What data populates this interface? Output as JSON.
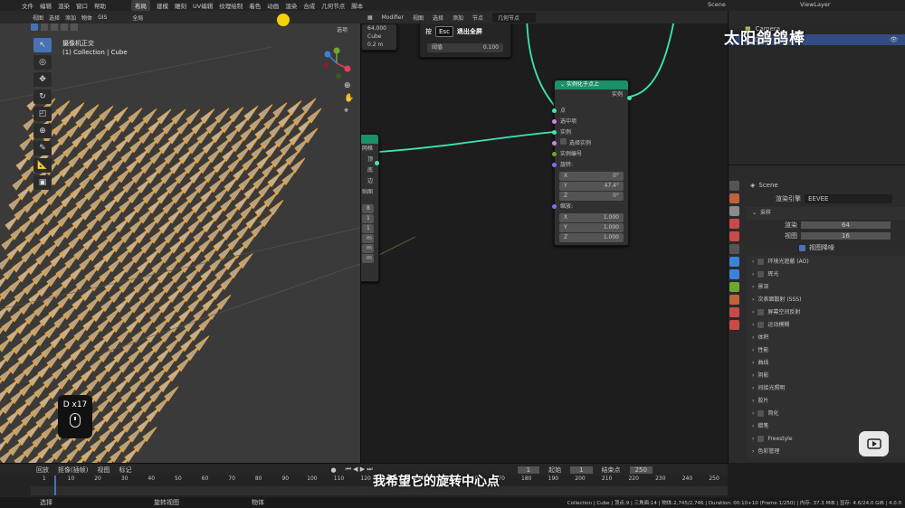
{
  "topbar": {
    "menus": [
      "文件",
      "编辑",
      "渲染",
      "窗口",
      "帮助"
    ],
    "workspaces": [
      "布局",
      "建模",
      "雕刻",
      "UV编辑",
      "纹理绘制",
      "着色",
      "动画",
      "渲染",
      "合成",
      "几何节点",
      "脚本"
    ],
    "active_workspace": "布局",
    "scene": "Scene",
    "view_layer": "ViewLayer"
  },
  "viewport": {
    "menus": [
      "视图",
      "选择",
      "添加",
      "物体",
      "GIS"
    ],
    "orientation": "全局",
    "options_label": "选项",
    "title_line1": "摄像机正交",
    "title_line2": "(1) Collection | Cube",
    "key_overlay": "D x17",
    "accent": "#e8a33c"
  },
  "node_editor": {
    "editor_type": "Modifier",
    "menus": [
      "视图",
      "选择",
      "添加",
      "节点"
    ],
    "node_group": "几何节点",
    "popup_value": "64.000",
    "popup_cube": "Cube",
    "popup_extra": "0.2 m",
    "hint_press": "按",
    "hint_key": "Esc",
    "hint_action": "退出全屏",
    "threshold_label": "阈值",
    "threshold_value": "0.100",
    "left_node_header": "",
    "left_node_rows": [
      "网格",
      "顶",
      "底",
      "边",
      "贴图"
    ],
    "left_node_values": [
      "8",
      "1",
      "1",
      "m",
      "m",
      "m"
    ],
    "instance_node": {
      "title": "实例化于点上",
      "output": "实例",
      "inputs": [
        "点",
        "选中项",
        "实例"
      ],
      "pick_instance": "选择实例",
      "instance_index": "实例编号",
      "rotation_label": "旋转:",
      "rotation": [
        {
          "axis": "X",
          "value": "0°"
        },
        {
          "axis": "Y",
          "value": "47.4°"
        },
        {
          "axis": "Z",
          "value": "0°"
        }
      ],
      "scale_label": "缩放:",
      "scale": [
        {
          "axis": "X",
          "value": "1.000"
        },
        {
          "axis": "Y",
          "value": "1.000"
        },
        {
          "axis": "Z",
          "value": "1.000"
        }
      ]
    },
    "link_color": "#3ee6b4"
  },
  "outliner": {
    "items": [
      {
        "name": "Camera"
      },
      {
        "name": "Cube"
      }
    ]
  },
  "properties": {
    "scene_label": "Scene",
    "render_engine_label": "渲染引擎",
    "render_engine_value": "EEVEE",
    "sampling_label": "采样",
    "render_label": "渲染",
    "render_samples": "64",
    "viewport_label": "视图",
    "viewport_samples": "16",
    "denoise_label": "视图降噪",
    "panels": [
      "环境光遮蔽 (AO)",
      "辉光",
      "景深",
      "次表面散射 (SSS)",
      "屏幕空间反射",
      "运动模糊",
      "体积",
      "性能",
      "曲线",
      "阴影",
      "间接光照明",
      "胶片",
      "简化",
      "蜡笔",
      "Freestyle",
      "色彩管理"
    ],
    "checkbox_panels": [
      0,
      1,
      4,
      5,
      12,
      14
    ]
  },
  "timeline": {
    "menus": [
      "回放",
      "抠像(插帧)",
      "视图",
      "标记"
    ],
    "current_frame": "1",
    "start_label": "起始",
    "start": "1",
    "end_label": "结束点",
    "end": "250",
    "ruler": [
      "1",
      "10",
      "20",
      "30",
      "40",
      "50",
      "60",
      "70",
      "80",
      "90",
      "100",
      "110",
      "120",
      "130",
      "140",
      "150",
      "160",
      "170",
      "180",
      "190",
      "200",
      "210",
      "220",
      "230",
      "240",
      "250"
    ]
  },
  "statusbar": {
    "left": "选择",
    "middle": "旋转视图",
    "right": "物体",
    "stats": "Collection | Cube | 顶点:9 | 三角面:14 | 物体:2,745/2,746 | Duration: 00:10+10 (Frame 1/250) | 内存: 37.3 MiB | 显存: 4.6/24.0 GiB | 4.0.0"
  },
  "subtitle": "我希望它的旋转中心点",
  "watermark": "太阳鸽鸽棒"
}
